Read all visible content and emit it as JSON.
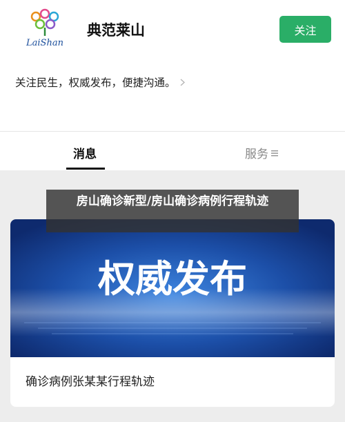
{
  "account": {
    "name": "典范莱山",
    "logo_text": "LaiShan",
    "follow_label": "关注",
    "bio": "关注民生，权威发布，便捷沟通。"
  },
  "tabs": [
    {
      "label": "消息",
      "active": true
    },
    {
      "label": "服务",
      "active": false
    }
  ],
  "overlay": {
    "title": "房山确诊新型/房山确诊病例行程轨迹"
  },
  "article": {
    "banner_text": "权威发布",
    "title": "确诊病例张某某行程轨迹"
  },
  "colors": {
    "follow_button": "#2aae67",
    "banner_dark": "#0e2a6e",
    "banner_light": "#3f86e0"
  },
  "icons": [
    "logo-flower-icon",
    "chevron-right-icon",
    "menu-lines-icon"
  ]
}
